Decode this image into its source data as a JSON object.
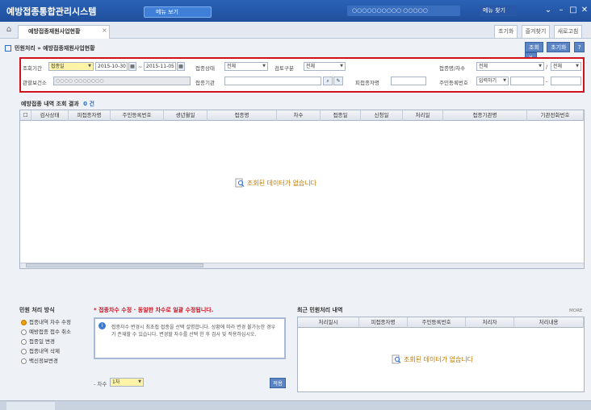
{
  "app": {
    "title": "예방접종통합관리시스템",
    "menu_label": "메뉴 보기",
    "user_info": "○○○○○○○○○○ ○○○○○",
    "notice": "메뉴 찾기"
  },
  "tabs": {
    "active": "예방접종재원사업현황",
    "right_buttons": [
      "초기화",
      "즐겨찾기",
      "새로고침"
    ]
  },
  "breadcrumb": {
    "text": "민원처리 » 예방접종재원사업현황",
    "buttons": [
      "조회",
      "초기화",
      "?",
      "X"
    ]
  },
  "search": {
    "row1": {
      "period_label": "조회기간",
      "period_type": "접종일",
      "date_from": "2015-10-30",
      "date_to": "2015-11-05",
      "vaccine_status_label": "접종상태",
      "vaccine_status": "전체",
      "review_label": "검토구분",
      "review": "전체",
      "dose_label": "접종명/차수",
      "dose_name": "전체",
      "dose_num": "전체"
    },
    "row2": {
      "clinic_label": "관할보건소",
      "clinic_value": "○○○○ ○○○○○○○",
      "agency_label": "접종기관",
      "agency_value": "",
      "recipient_label": "피접종자명",
      "recipient_value": "",
      "rrn_label": "주민등록번호",
      "rrn_value": "입력하기"
    }
  },
  "list": {
    "title": "예방접종 내역 조회 결과",
    "count": "0 건",
    "columns": [
      "",
      "검사상태",
      "피접종자명",
      "주민등록번호",
      "생년월일",
      "접종명",
      "차수",
      "접종일",
      "신청일",
      "처리일",
      "접종기관명",
      "기관전화번호"
    ],
    "empty_message": "조회된 데이터가 없습니다"
  },
  "process": {
    "title": "민원 처리 방식",
    "options": [
      "접종내역 차수 수정",
      "예방접종 접수 취소",
      "접종일 변경",
      "접종내역 삭제",
      "백신정보변경"
    ],
    "selected": 0,
    "warning": "* 접종차수 수정 · 동일한 차수로 일괄 수정됩니다.",
    "info": "접종차수 변경시 최초접 접종을 선택 설명합니다. 상황에 따라 변경 불가능한 경우가 존재할 수 있습니다. 변경할 차수를 선택 한 후 검사 및 적용하십시오.",
    "dose_label": "- 차수",
    "dose_value": "1차",
    "apply_label": "적용"
  },
  "recent": {
    "title": "최근 민원처리 내역",
    "more": "MORE",
    "columns": [
      "처리일시",
      "피접종자명",
      "주민등록번호",
      "처리자",
      "처리내용"
    ],
    "empty_message": "조회된 데이터가 없습니다"
  },
  "colors": {
    "highlight_border": "#d0111e",
    "titlebar": "#1f4f9c",
    "accent": "#5a84c4"
  }
}
